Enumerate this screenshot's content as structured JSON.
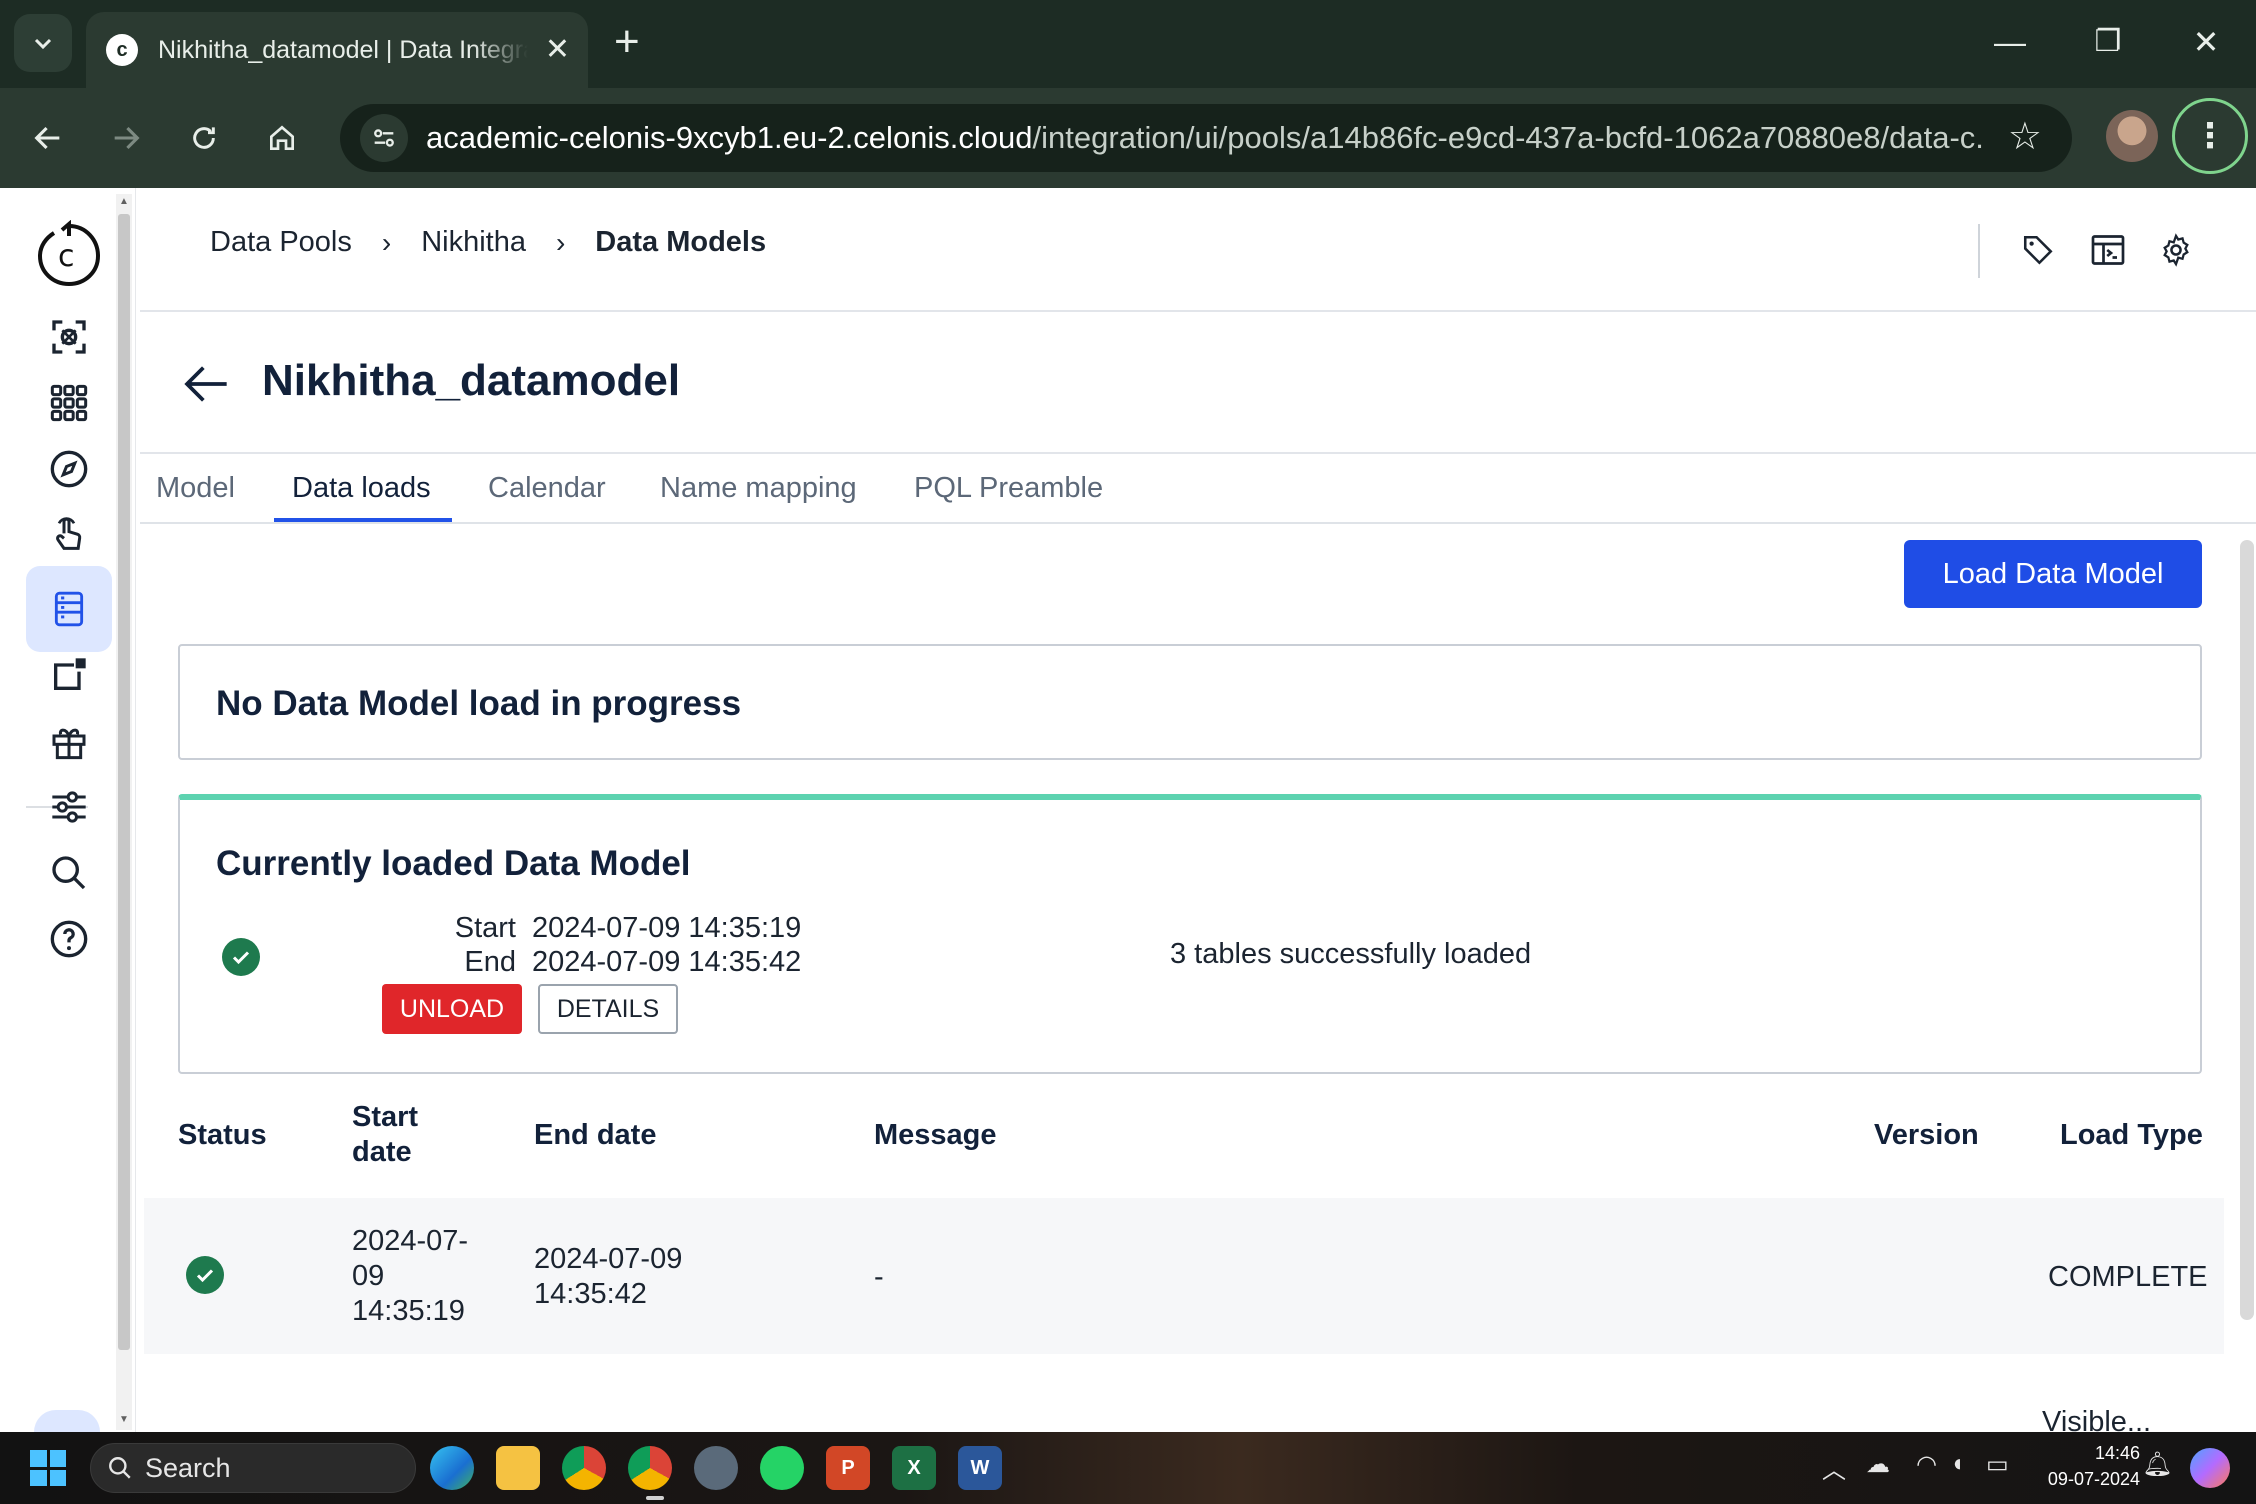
{
  "browser": {
    "tab_title": "Nikhitha_datamodel | Data Integration",
    "tab_favicon": "c",
    "url_host": "academic-celonis-9xcyb1.eu-2.celonis.cloud",
    "url_path": "/integration/ui/pools/a14b86fc-e9cd-437a-bcfd-1062a70880e8/data-c...",
    "new_tab": "+",
    "close_tab": "✕",
    "win_minimize": "—",
    "win_restore": "❐",
    "win_close": "✕"
  },
  "breadcrumb": {
    "items": [
      "Data Pools",
      "Nikhitha"
    ],
    "current": "Data Models",
    "separator": "›"
  },
  "page": {
    "title": "Nikhitha_datamodel"
  },
  "tabs": [
    "Model",
    "Data loads",
    "Calendar",
    "Name mapping",
    "PQL Preamble"
  ],
  "active_tab": "Data loads",
  "actions": {
    "load_button": "Load Data Model"
  },
  "progress_card": {
    "text": "No Data Model load in progress"
  },
  "loaded_card": {
    "heading": "Currently loaded Data Model",
    "start_label": "Start",
    "start_value": "2024-07-09 14:35:19",
    "end_label": "End",
    "end_value": "2024-07-09 14:35:42",
    "unload_label": "UNLOAD",
    "details_label": "DETAILS",
    "message": "3 tables successfully loaded"
  },
  "table": {
    "headers": {
      "status": "Status",
      "start_date": "Start date",
      "end_date": "End date",
      "message": "Message",
      "version": "Version",
      "load_type": "Load Type"
    },
    "rows": [
      {
        "start_date": "2024-07-09 14:35:19",
        "end_date": "2024-07-09 14:35:42",
        "message": "-",
        "version": "",
        "load_type": "COMPLETE"
      }
    ],
    "footer_partial": "Visible..."
  },
  "taskbar": {
    "search_label": "Search",
    "time": "14:46",
    "date": "09-07-2024"
  },
  "colors": {
    "accent_blue": "#1f4de6",
    "success_green": "#1e7a4e",
    "loaded_border": "#5dd3b0",
    "danger_red": "#e0262a",
    "chrome_dark": "#1d2c24"
  }
}
